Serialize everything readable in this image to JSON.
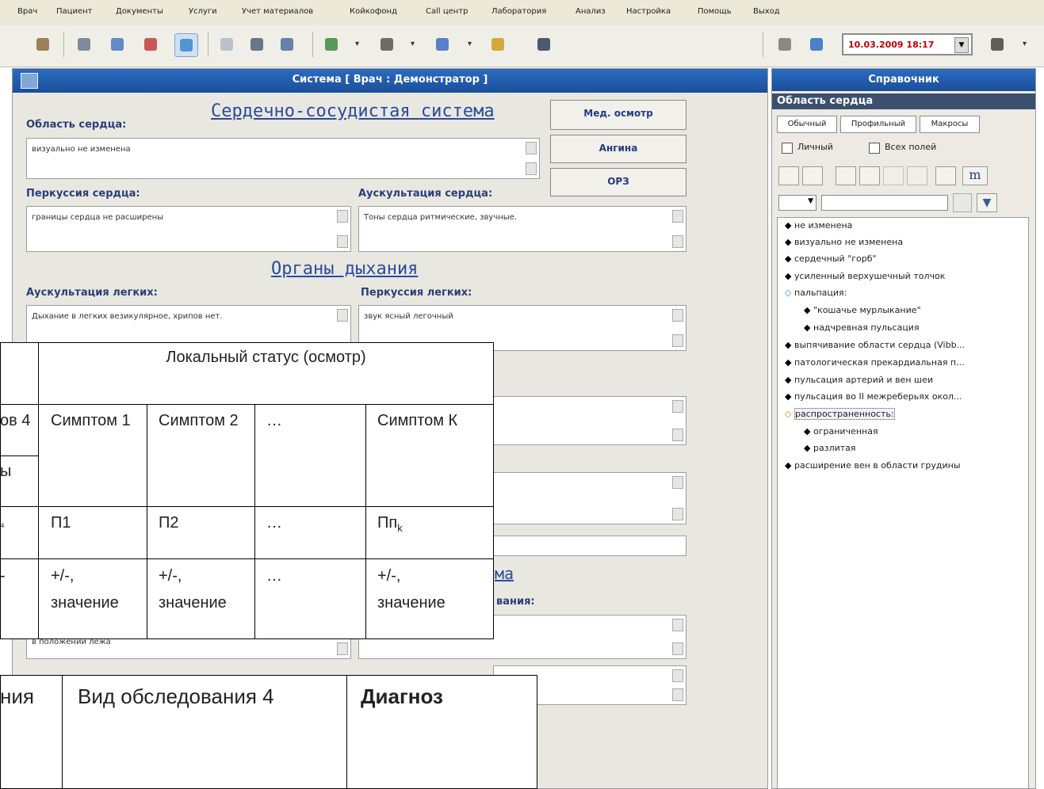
{
  "menu": [
    "Врач",
    "Пациент",
    "Документы",
    "Услуги",
    "Учет материалов",
    "Койкофонд",
    "Call центр",
    "Лаборатория",
    "Анализ",
    "Настройка",
    "Помощь",
    "Выход"
  ],
  "datetime": "10.03.2009 18:17",
  "main": {
    "title": "Система  [ Врач : Демонстратор ]",
    "section_heart": "Сердечно-сосудистая система",
    "heart_area_label": "Область сердца:",
    "heart_area_value": "визуально не изменена",
    "percussion_label": "Перкуссия сердца:",
    "percussion_value": "границы сердца не расширены",
    "auscultation_label": "Аускультация сердца:",
    "auscultation_value": "Тоны сердца ритмические, звучные.",
    "section_resp": "Органы дыхания",
    "lung_ausc_label": "Аускультация легких:",
    "lung_ausc_value": "Дыхание в легких везикулярное, хрипов нет.",
    "lung_perc_label": "Перкуссия легких:",
    "lung_perc_value": "звук ясный легочный",
    "partial_section": "ма",
    "partial_label": "вания:",
    "partial_value": "в положении лежа"
  },
  "buttons": {
    "med_exam": "Мед. осмотр",
    "angina": "Ангина",
    "orz": "ОРЗ"
  },
  "right": {
    "title": "Справочник",
    "subtitle": "Область сердца",
    "tabs": [
      "Обычный",
      "Профильный",
      "Макросы"
    ],
    "check_personal": "Личный",
    "check_all": "Всех полей",
    "m_button": "m",
    "tree": [
      "не изменена",
      "визуально не изменена",
      "сердечный \"горб\"",
      "усиленный верхушечный толчок",
      "пальпация:",
      "\"кошачье мурлыкание\"",
      "надчревная пульсация",
      "выпячивание области сердца (Vibb...",
      "патологическая прекардиальная п...",
      "пульсация артерий и вен шеи",
      "пульсация во II межреберьях окол...",
      "распространенность:",
      "ограниченная",
      "разлитая",
      "расширение вен в области грудины"
    ]
  },
  "overlay_table": {
    "header": "Локальный статус (осмотр)",
    "left_frag": [
      "ов 4",
      "ы",
      "₄",
      "-"
    ],
    "symptoms": [
      "Симптом 1",
      "Симптом 2",
      "…",
      "Симптом К"
    ],
    "params": [
      "П1",
      "П2",
      "…",
      "Пп"
    ],
    "param_sub": "k",
    "values": [
      "+/-, значение",
      "+/-, значение",
      "…",
      "+/-, значение"
    ]
  },
  "overlay_table2": {
    "frag": "ния",
    "exam4": "Вид обследования 4",
    "diagnosis": "Диагноз"
  }
}
